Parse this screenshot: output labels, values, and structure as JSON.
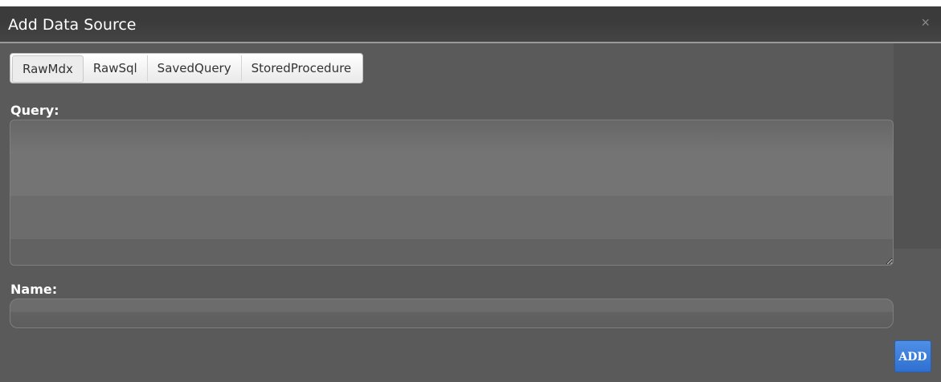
{
  "dialog": {
    "title": "Add Data Source",
    "close_glyph": "×",
    "close_icon": "close-icon"
  },
  "tabs": [
    {
      "label": "RawMdx",
      "active": true
    },
    {
      "label": "RawSql",
      "active": false
    },
    {
      "label": "SavedQuery",
      "active": false
    },
    {
      "label": "StoredProcedure",
      "active": false
    }
  ],
  "form": {
    "query_label": "Query:",
    "query_value": "",
    "name_label": "Name:",
    "name_value": ""
  },
  "actions": {
    "add_label": "ADD"
  },
  "colors": {
    "accent": "#3a78d8",
    "background": "#5a5a5a",
    "titlebar": "#3b3b3b"
  }
}
